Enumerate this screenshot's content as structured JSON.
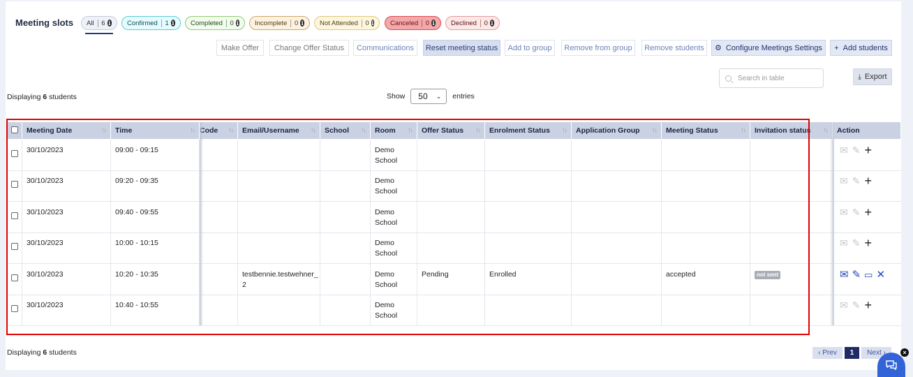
{
  "header": {
    "title": "Meeting slots"
  },
  "status_filters": [
    {
      "label": "All",
      "count": "6",
      "text_color": "#333333",
      "bg": "#eef1f8",
      "border": "#c5cbd8"
    },
    {
      "label": "Confirmed",
      "count": "1",
      "text_color": "#0d4d57",
      "bg": "#e6fbfd",
      "border": "#5cc9d6"
    },
    {
      "label": "Completed",
      "count": "0",
      "text_color": "#234a16",
      "bg": "#f2fbee",
      "border": "#8fcd73"
    },
    {
      "label": "Incomplete",
      "count": "0",
      "text_color": "#5a3b10",
      "bg": "#fbf2e2",
      "border": "#d1a665"
    },
    {
      "label": "Not Attended",
      "count": "0",
      "text_color": "#4e4310",
      "bg": "#fcf6e0",
      "border": "#dfc777"
    },
    {
      "label": "Canceled",
      "count": "0",
      "text_color": "#6a1010",
      "bg": "#f3a8aa",
      "border": "#d94a4f"
    },
    {
      "label": "Declined",
      "count": "0",
      "text_color": "#5a1414",
      "bg": "#fde8e8",
      "border": "#e39a9a"
    }
  ],
  "toolbar": {
    "make_offer": "Make Offer",
    "change_offer_status": "Change Offer Status",
    "communications": "Communications",
    "reset_meeting_status": "Reset meeting status",
    "add_to_group": "Add to group",
    "remove_from_group": "Remove from group",
    "remove_students": "Remove students",
    "configure_meetings": "Configure Meetings Settings",
    "add_students": "Add students"
  },
  "search": {
    "placeholder": "Search in table"
  },
  "export_label": "Export",
  "display_count": {
    "prefix": "Displaying",
    "count": "6",
    "suffix": "students"
  },
  "page_length": {
    "show": "Show",
    "value": "50",
    "entries": "entries"
  },
  "columns": {
    "meeting_date": "Meeting Date",
    "time": "Time",
    "code": "Code",
    "email": "Email/Username",
    "school": "School",
    "room": "Room",
    "offer_status": "Offer Status",
    "enrolment_status": "Enrolment Status",
    "application_group": "Application Group",
    "meeting_status": "Meeting Status",
    "invitation_status": "Invitation status",
    "action": "Action"
  },
  "rows": [
    {
      "date": "30/10/2023",
      "time": "09:00 - 09:15",
      "email": "",
      "room": "Demo School",
      "offer": "",
      "enrolment": "",
      "meeting_status": "",
      "invitation": ""
    },
    {
      "date": "30/10/2023",
      "time": "09:20 - 09:35",
      "email": "",
      "room": "Demo School",
      "offer": "",
      "enrolment": "",
      "meeting_status": "",
      "invitation": ""
    },
    {
      "date": "30/10/2023",
      "time": "09:40 - 09:55",
      "email": "",
      "room": "Demo School",
      "offer": "",
      "enrolment": "",
      "meeting_status": "",
      "invitation": ""
    },
    {
      "date": "30/10/2023",
      "time": "10:00 - 10:15",
      "email": "",
      "room": "Demo School",
      "offer": "",
      "enrolment": "",
      "meeting_status": "",
      "invitation": ""
    },
    {
      "date": "30/10/2023",
      "time": "10:20 - 10:35",
      "email": "testbennie.testwehner_2",
      "room": "Demo School",
      "offer": "Pending",
      "enrolment": "Enrolled",
      "meeting_status": "accepted",
      "invitation": "not sent"
    },
    {
      "date": "30/10/2023",
      "time": "10:40 - 10:55",
      "email": "",
      "room": "Demo School",
      "offer": "",
      "enrolment": "",
      "meeting_status": "",
      "invitation": ""
    }
  ],
  "pagination": {
    "prev": "‹ Prev",
    "page": "1",
    "next": "Next ›"
  },
  "colors": {
    "accent": "#1f2a66",
    "header_bg": "#c9d1e3",
    "highlight_box": "#e00000"
  }
}
